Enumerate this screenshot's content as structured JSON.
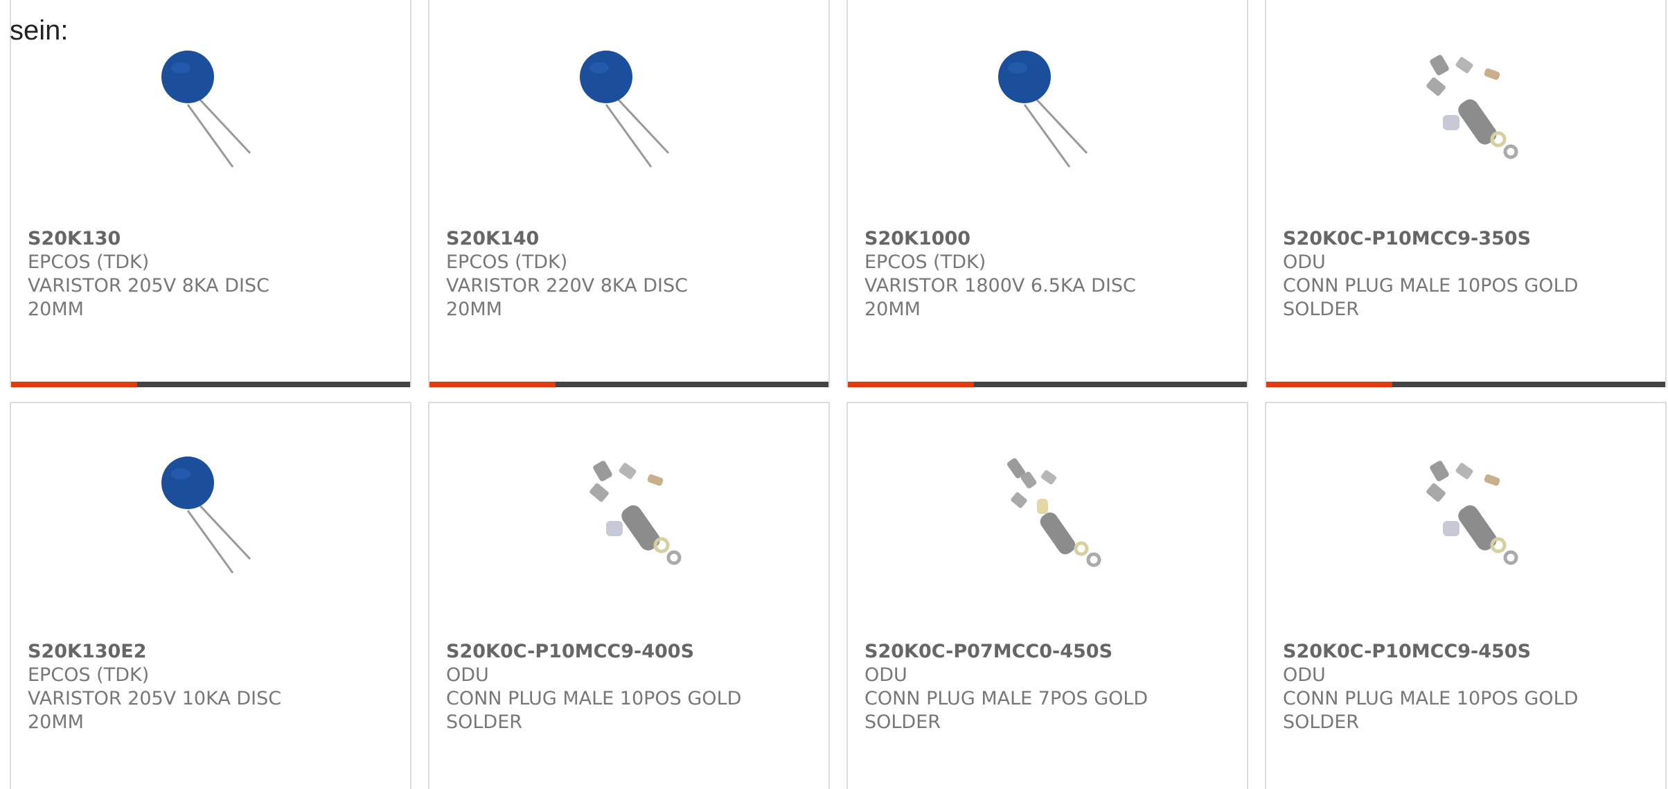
{
  "intro_text": "sein:",
  "colors": {
    "accent": "#e03a0e",
    "bar": "#444444",
    "varistor_blue": "#1b4f9c"
  },
  "products": [
    {
      "part_number": "S20K130",
      "manufacturer": "EPCOS (TDK)",
      "description": "VARISTOR 205V 8KA DISC 20MM",
      "image": "varistor-disc-icon"
    },
    {
      "part_number": "S20K140",
      "manufacturer": "EPCOS (TDK)",
      "description": "VARISTOR 220V 8KA DISC 20MM",
      "image": "varistor-disc-icon"
    },
    {
      "part_number": "S20K1000",
      "manufacturer": "EPCOS (TDK)",
      "description": "VARISTOR 1800V 6.5KA DISC 20MM",
      "image": "varistor-disc-icon"
    },
    {
      "part_number": "S20K0C-P10MCC9-350S",
      "manufacturer": "ODU",
      "description": "CONN PLUG MALE 10POS GOLD SOLDER",
      "image": "connector-parts-icon"
    },
    {
      "part_number": "S20K130E2",
      "manufacturer": "EPCOS (TDK)",
      "description": "VARISTOR 205V 10KA DISC 20MM",
      "image": "varistor-disc-icon"
    },
    {
      "part_number": "S20K0C-P10MCC9-400S",
      "manufacturer": "ODU",
      "description": "CONN PLUG MALE 10POS GOLD SOLDER",
      "image": "connector-parts-icon"
    },
    {
      "part_number": "S20K0C-P07MCC0-450S",
      "manufacturer": "ODU",
      "description": "CONN PLUG MALE 7POS GOLD SOLDER",
      "image": "connector-parts-icon"
    },
    {
      "part_number": "S20K0C-P10MCC9-450S",
      "manufacturer": "ODU",
      "description": "CONN PLUG MALE 10POS GOLD SOLDER",
      "image": "connector-parts-icon"
    }
  ]
}
